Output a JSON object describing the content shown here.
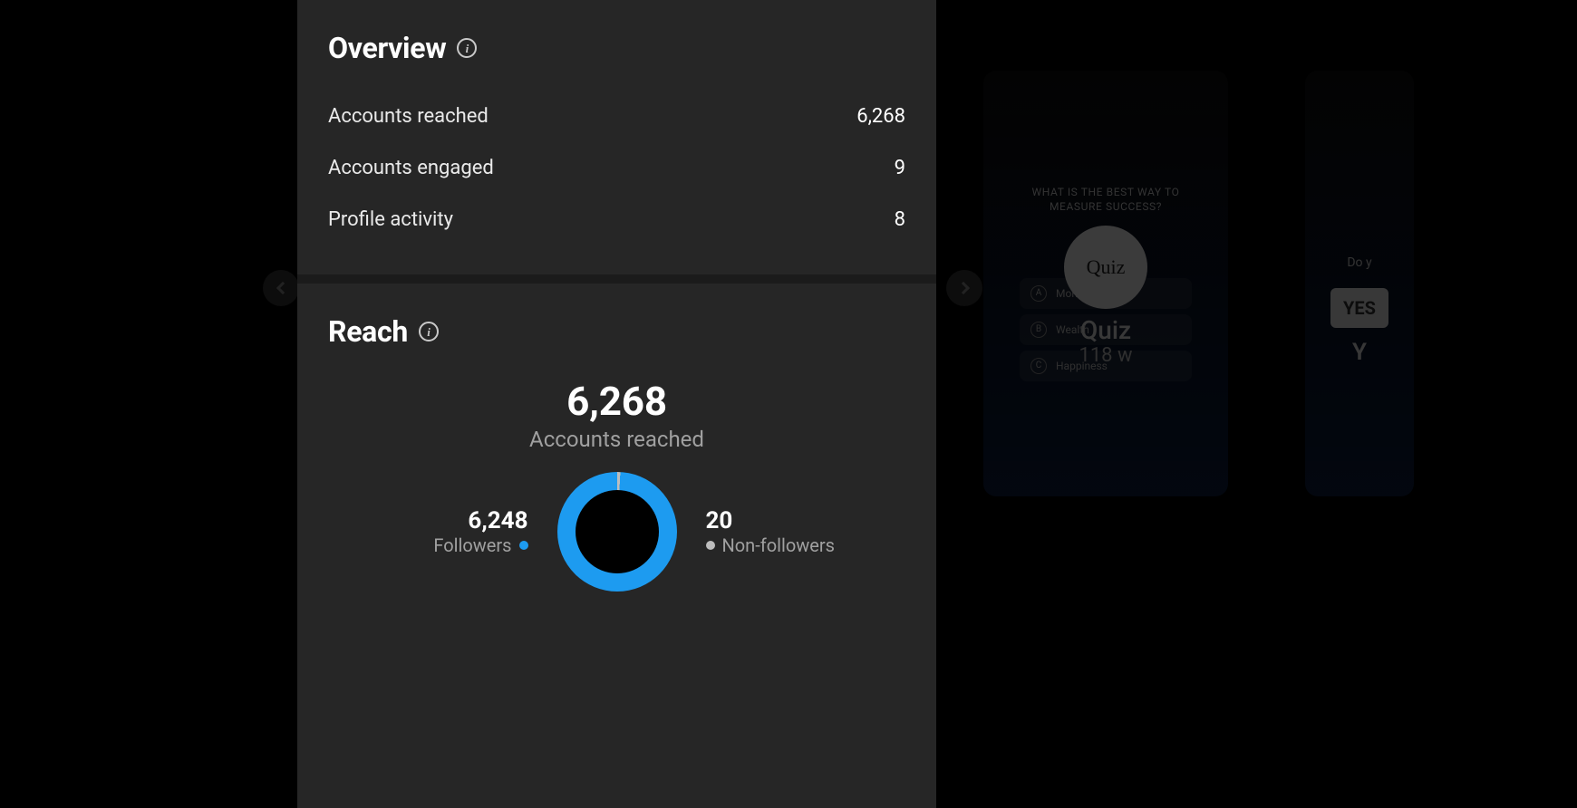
{
  "overview": {
    "title": "Overview",
    "rows": [
      {
        "label": "Accounts reached",
        "value": "6,268"
      },
      {
        "label": "Accounts engaged",
        "value": "9"
      },
      {
        "label": "Profile activity",
        "value": "8"
      }
    ]
  },
  "reach": {
    "title": "Reach",
    "total_value": "6,268",
    "total_label": "Accounts reached",
    "followers": {
      "value": "6,248",
      "label": "Followers"
    },
    "non_followers": {
      "value": "20",
      "label": "Non-followers"
    }
  },
  "stories": {
    "quiz": {
      "heading_line1": "WHAT IS THE BEST WAY TO",
      "heading_line2": "MEASURE SUCCESS?",
      "avatar_text": "Quiz",
      "options": {
        "a": "Money",
        "b": "Wealth",
        "c": "Happiness"
      },
      "overlay_title": "Quiz",
      "overlay_time": "118 w"
    },
    "poll": {
      "prompt": "Do y",
      "option_yes": "YES",
      "overlay_letter": "Y"
    }
  },
  "chart_data": {
    "type": "pie",
    "title": "Accounts reached",
    "categories": [
      "Followers",
      "Non-followers"
    ],
    "values": [
      6248,
      20
    ],
    "colors": {
      "Followers": "#1d9bf0",
      "Non-followers": "#bdbdbd"
    }
  }
}
